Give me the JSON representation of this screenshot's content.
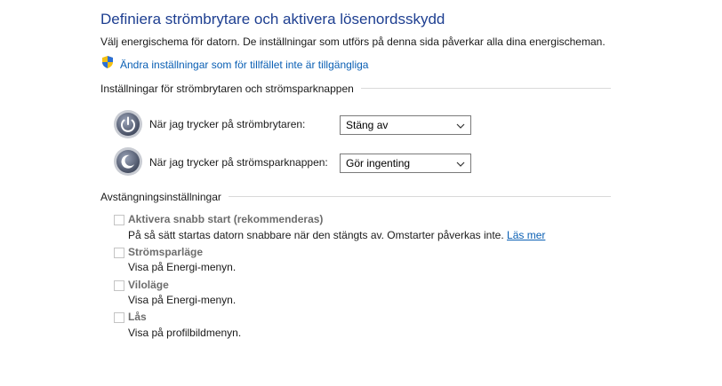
{
  "header": {
    "title": "Definiera strömbrytare och aktivera lösenordsskydd",
    "subtitle": "Välj energischema för datorn. De inställningar som utförs på denna sida påverkar alla dina energischeman.",
    "change_link": "Ändra inställningar som för tillfället inte är tillgängliga"
  },
  "power_buttons": {
    "section_title": "Inställningar för strömbrytaren och strömsparknappen",
    "power_button_label": "När jag trycker på strömbrytaren:",
    "power_button_value": "Stäng av",
    "sleep_button_label": "När jag trycker på strömsparknappen:",
    "sleep_button_value": "Gör ingenting"
  },
  "shutdown": {
    "section_title": "Avstängningsinställningar",
    "fast_startup_title": "Aktivera snabb start (rekommenderas)",
    "fast_startup_desc": "På så sätt startas datorn snabbare när den stängts av. Omstarter påverkas inte.",
    "learn_more": "Läs mer",
    "sleep_title": "Strömsparläge",
    "sleep_desc": "Visa på Energi-menyn.",
    "hibernate_title": "Viloläge",
    "hibernate_desc": "Visa på Energi-menyn.",
    "lock_title": "Lås",
    "lock_desc": "Visa på profilbildmenyn."
  },
  "colors": {
    "title": "#1e3f91",
    "link": "#0a5fb4",
    "disabled_text": "#6d6d6d"
  },
  "icons": [
    "shield-icon",
    "power-button-icon",
    "sleep-button-icon",
    "chevron-down-icon"
  ]
}
